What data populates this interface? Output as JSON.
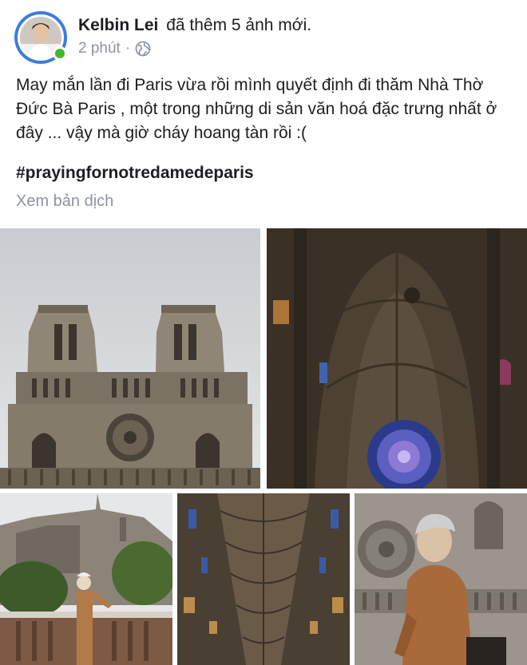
{
  "post": {
    "author": "Kelbin Lei",
    "action": "đã thêm 5 ảnh mới.",
    "time": "2 phút",
    "separator": "·",
    "privacy_icon": "globe-icon",
    "text": "May mắn lần đi Paris vừa rồi mình quyết định đi thăm Nhà Thờ Đức Bà Paris , một trong những di sản văn hoá đặc trưng nhất ở đây ... vậy mà giờ cháy hoang tàn rồi :(",
    "hashtag": "#prayingfornotredamedeparis",
    "see_translation": "Xem bản dịch"
  },
  "colors": {
    "avatar_ring": "#3b7de0",
    "online": "#42b72a",
    "secondary_text": "#8d949e"
  }
}
